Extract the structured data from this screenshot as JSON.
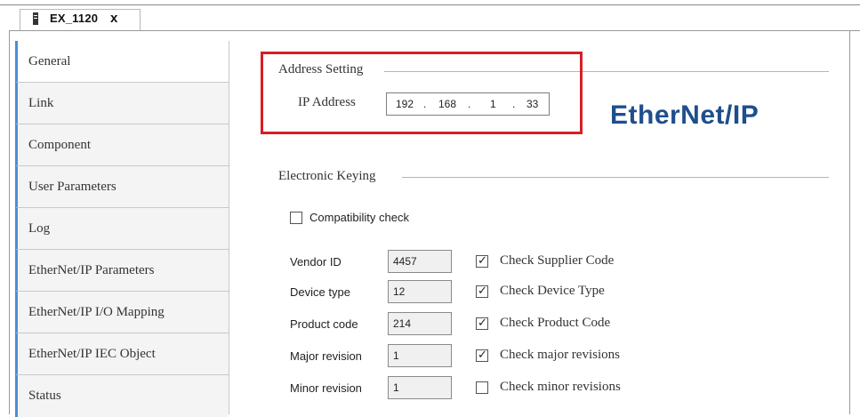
{
  "tab": {
    "title": "EX_1120",
    "close": "x"
  },
  "sidebar": {
    "items": [
      {
        "label": "General",
        "active": true
      },
      {
        "label": "Link",
        "active": false
      },
      {
        "label": "Component",
        "active": false
      },
      {
        "label": "User Parameters",
        "active": false
      },
      {
        "label": "Log",
        "active": false
      },
      {
        "label": "EtherNet/IP Parameters",
        "active": false
      },
      {
        "label": "EtherNet/IP I/O Mapping",
        "active": false
      },
      {
        "label": "EtherNet/IP IEC Object",
        "active": false
      },
      {
        "label": "Status",
        "active": false
      }
    ]
  },
  "address": {
    "section_title": "Address Setting",
    "ip_label": "IP Address",
    "ip": [
      "192",
      "168",
      "1",
      "33"
    ],
    "dot": "."
  },
  "logo": {
    "text": "EtherNet/IP"
  },
  "keying": {
    "section_title": "Electronic Keying",
    "compat_label": "Compatibility check",
    "compat_checked": false,
    "rows": [
      {
        "label": "Vendor ID",
        "value": "4457",
        "check_label": "Check Supplier Code",
        "checked": true
      },
      {
        "label": "Device type",
        "value": "12",
        "check_label": "Check Device Type",
        "checked": true
      },
      {
        "label": "Product code",
        "value": "214",
        "check_label": "Check Product Code",
        "checked": true
      },
      {
        "label": "Major revision",
        "value": "1",
        "check_label": "Check major revisions",
        "checked": true
      },
      {
        "label": "Minor revision",
        "value": "1",
        "check_label": "Check minor revisions",
        "checked": false
      }
    ]
  },
  "colors": {
    "highlight": "#d61f26",
    "accent": "#4a8fd8",
    "logo": "#1f4e8c"
  },
  "icons": {
    "tab": "device-icon",
    "checked": "checkmark-icon"
  }
}
